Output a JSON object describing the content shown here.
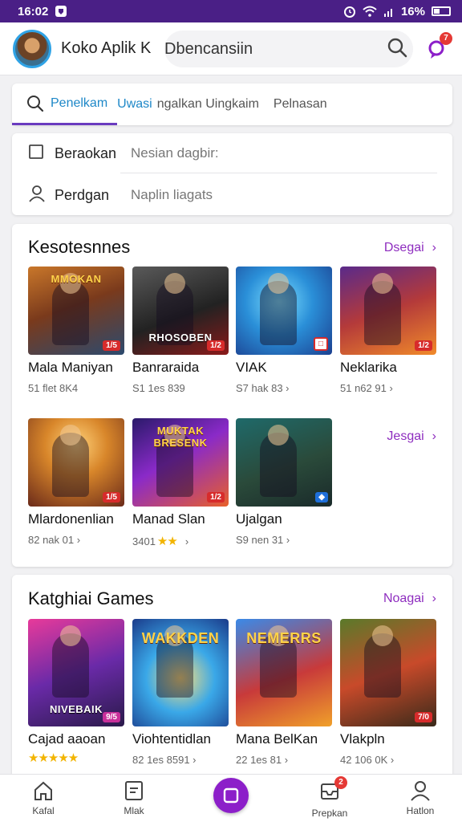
{
  "status_bar": {
    "time": "16:02",
    "battery": "16%"
  },
  "header": {
    "title": "Koko Aplik K",
    "search_text": "Dbencansiin",
    "notif_count": "7"
  },
  "tabs": [
    {
      "label": "Penelkam"
    },
    {
      "label": "Uwasi"
    },
    {
      "label": "ngalkan Uingkaim"
    },
    {
      "label": "Pelnasan"
    }
  ],
  "filters": [
    {
      "label": "Beraokan",
      "value": "Nesian dagbir:"
    },
    {
      "label": "Perdgan",
      "value": "Naplin liagats"
    }
  ],
  "section1": {
    "title": "Kesotesnnes",
    "more_label": "Dsegai",
    "more_label_2": "Jesgai",
    "games": [
      {
        "name": "Mala Maniyan",
        "meta": "51 flet 8K4",
        "art": "MMOKAN",
        "badge": "1/5"
      },
      {
        "name": "Banraraida",
        "meta": "S1 1es 839",
        "art": "RHOSOBEN",
        "badge": "1/2"
      },
      {
        "name": "VIAK",
        "meta": "S7 hak 83 ›",
        "art": "",
        "badge": ""
      },
      {
        "name": "Neklarika",
        "meta": "51 n62 91 ›",
        "art": "",
        "badge": "1/2"
      },
      {
        "name": "Mlardonenlian",
        "meta": "82 nak 01 ›",
        "art": "",
        "badge": "1/5"
      },
      {
        "name": "Manad Slan",
        "meta": "3401",
        "art": "MUKTAK BRESENK",
        "badge": "1/2"
      },
      {
        "name": "Ujalgan",
        "meta": "S9 nen 31 ›",
        "art": "",
        "badge": ""
      }
    ],
    "rating_stars": "★★",
    "meta_suffix": "›"
  },
  "section2": {
    "title": "Katghiai Games",
    "more_label": "Noagai",
    "games": [
      {
        "name": "Cajad aaoan",
        "meta": "",
        "art": "NIVEBAIK",
        "badge": "9/5",
        "stars": "★★★★★"
      },
      {
        "name": "Viohtentidlan",
        "meta": "82 1es 8591 ›",
        "art": "WAKKDEN",
        "badge": ""
      },
      {
        "name": "Mana BelKan",
        "meta": "22 1es 81 ›",
        "art": "NEMERRS",
        "badge": ""
      },
      {
        "name": "Vlakpln",
        "meta": "42 106 0K ›",
        "art": "",
        "badge": "7/0"
      }
    ]
  },
  "bottom_nav": [
    {
      "label": "Kafal"
    },
    {
      "label": "Mlak"
    },
    {
      "label": ""
    },
    {
      "label": "Prepkan",
      "badge": "2"
    },
    {
      "label": "Hatlon"
    }
  ],
  "colors": {
    "accent": "#8c1fc9",
    "status_bar": "#4a1f86",
    "link": "#1e88c8"
  }
}
